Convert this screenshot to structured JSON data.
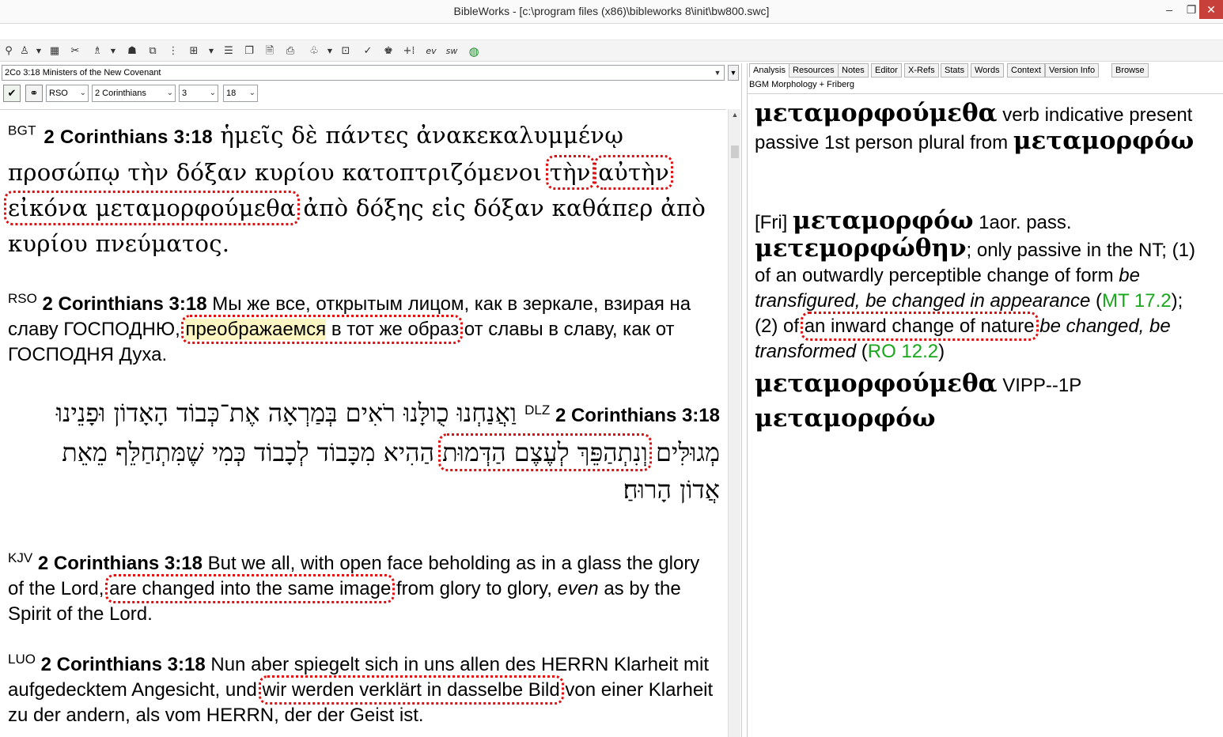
{
  "window": {
    "title": "BibleWorks - [c:\\program files (x86)\\bibleworks 8\\init\\bw800.swc]",
    "min": "–",
    "max": "❐",
    "close": "✕"
  },
  "toolbar": {
    "icons": [
      "search-icon",
      "user-icon",
      "calendar-icon",
      "tools-icon",
      "user-list-icon",
      "highlight-icon",
      "window-icon",
      "dots-icon",
      "grid-icon",
      "list-icon",
      "copy-icon",
      "doc-icon",
      "print-icon",
      "tree-icon",
      "layout-icon",
      "check-icon",
      "stamp-icon",
      "plus-icon",
      "ev-icon",
      "sw-icon",
      "globe-icon"
    ],
    "ev_label": "ev",
    "sw_label": "sw"
  },
  "left": {
    "reference_bar": "2Co 3:18 Ministers of the New Covenant",
    "version_select": "RSO",
    "book_select": "2 Corinthians",
    "chapter_select": "3",
    "verse_select": "18"
  },
  "verses": {
    "bgt": {
      "tag": "BGT",
      "ref": "2 Corinthians 3:18",
      "pre": " ἡμεῖς δὲ πάντες ἀνακεκαλυμμένῳ προσώπῳ τὴν δόξαν κυρίου κατοπτριζόμενοι ",
      "hl1": "τὴν",
      "space": " ",
      "hl2": "αὐτὴν εἰκόνα μεταμορφούμεθα",
      "post": " ἀπὸ δόξης εἰς δόξαν καθάπερ ἀπὸ κυρίου πνεύματος."
    },
    "rso": {
      "tag": "RSO",
      "ref": "2 Corinthians 3:18",
      "pre": " Мы же все, открытым лицом, как в зеркале, взирая на славу ГОСПОДНЮ, ",
      "hl_yellow": "преображаемся",
      "hl_rest": " в тот же образ",
      "post": " от славы в славу, как от ГОСПОДНЯ Духа."
    },
    "dlz": {
      "pre": "וַאֲנַחְנוּ כֻולָּנוּ רֹאִים בְּמַרְאָה אֶת־כְּבוֹד הָאָדוֹן וּפָנֵינוּ מְגוּלִּים ",
      "hl": "וְנִתְהַפֵּךְ לְעֶצֶם הַדְּמוּת",
      "post": " הַהִיא מִכָּבוֹד לְכָבוֹד כְּמִי שֶׁמִּתְחַלֵּף מֵאֵת אֲדוֹן הָרוּחַ׃",
      "tag": "DLZ",
      "ref": "2 Corinthians 3:18"
    },
    "kjv": {
      "tag": "KJV",
      "ref": "2 Corinthians 3:18",
      "pre": " But we all, with open face beholding as in a glass the glory of the Lord, ",
      "hl": "are changed into the same image",
      "post": " from glory to glory, ",
      "italic": "even",
      "end": " as by the Spirit of the Lord."
    },
    "luo": {
      "tag": "LUO",
      "ref": "2 Corinthians 3:18",
      "pre": " Nun aber spiegelt sich in uns allen des HERRN Klarheit mit aufgedecktem Angesicht, und ",
      "hl": "wir werden verklärt in dasselbe Bild",
      "post": " von einer Klarheit zu der andern, als vom HERRN, der der Geist ist."
    }
  },
  "right": {
    "tabs": [
      "Analysis",
      "Resources",
      "Notes",
      "Editor",
      "X-Refs",
      "Stats",
      "Words",
      "Context",
      "Version Info",
      "Browse"
    ],
    "subhead": "BGM Morphology + Friberg",
    "p1": {
      "word": "μεταμορφούμεθα",
      "desc": "  verb indicative present passive 1st person plural from ",
      "lemma": "μεταμορφόω"
    },
    "p2": {
      "tag": "[Fri] ",
      "word": "μεταμορφόω",
      "form": "  1aor. pass. ",
      "aor": "μετεμορφώθην",
      "text1": "; only passive in the NT; (1) of an outwardly perceptible change of form ",
      "it1": "be transfigured, be changed in appearance",
      "p1": " (",
      "ref1": "MT 17.2",
      "text2": "); (2) of ",
      "hl": "an inward change of nature",
      "space": " ",
      "it2": "be changed, be transformed",
      "p2": " (",
      "ref2": "RO 12.2",
      "close": ")"
    },
    "p3": {
      "word": "μεταμορφούμεθα",
      "code": "  VIPP--1P"
    },
    "p4": {
      "word": "μεταμορφόω"
    }
  }
}
